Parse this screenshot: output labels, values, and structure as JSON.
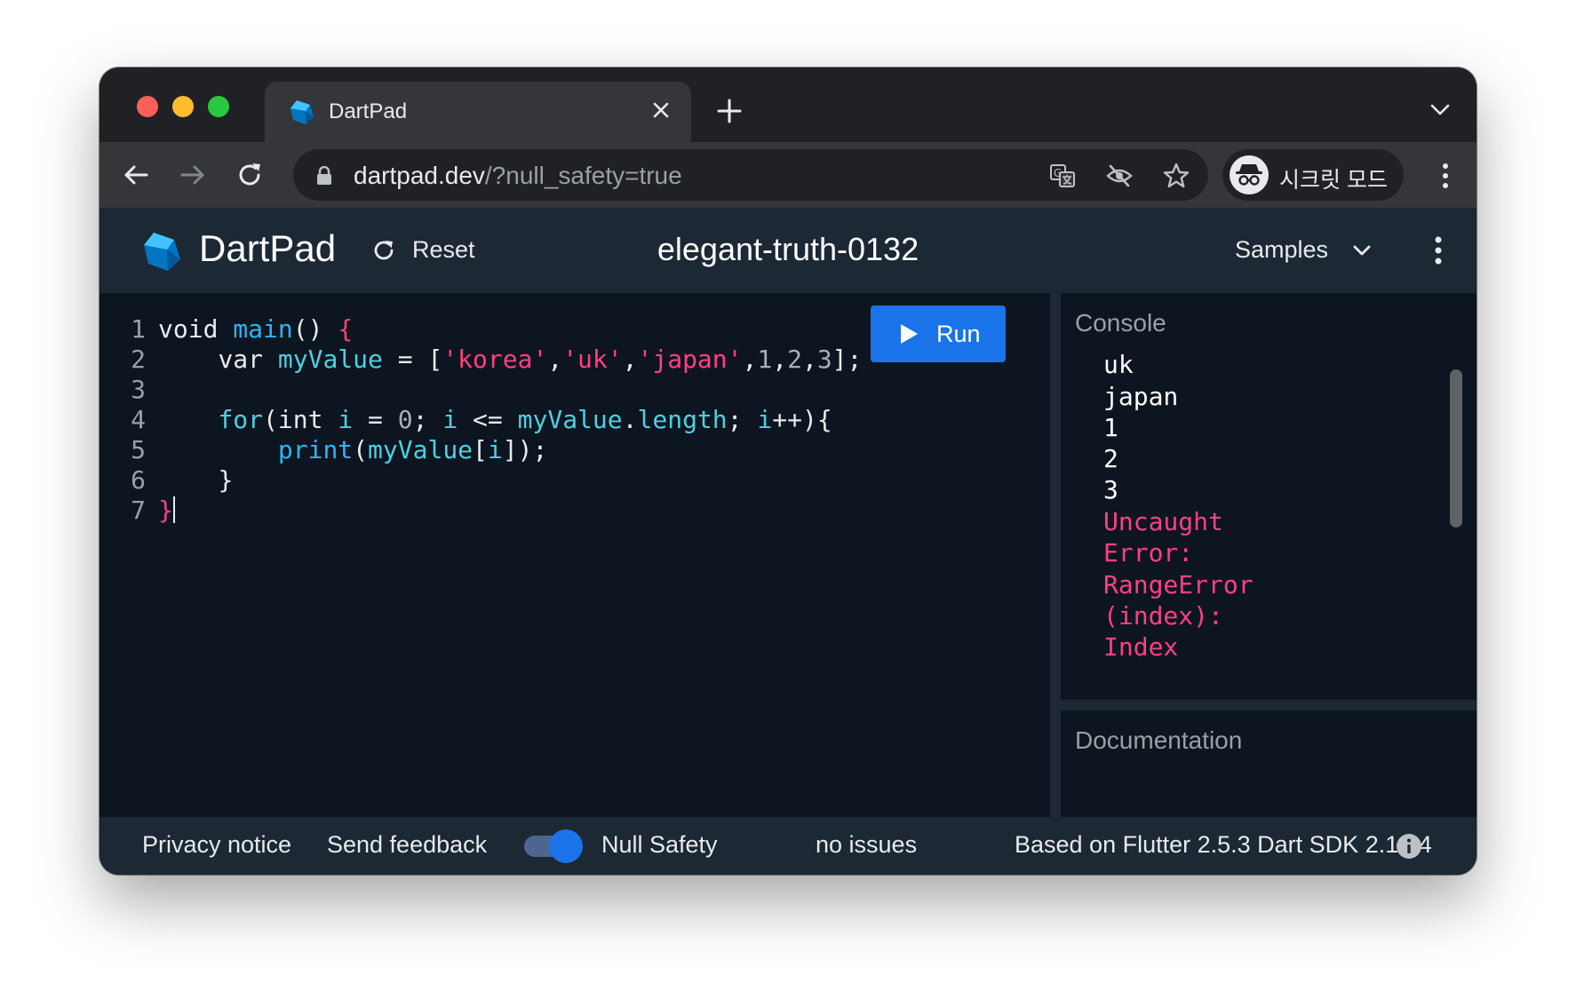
{
  "browser": {
    "tab": {
      "title": "DartPad"
    },
    "address": {
      "host": "dartpad.dev",
      "path": "/?null_safety=true"
    },
    "profile": {
      "label": "시크릿 모드"
    }
  },
  "app": {
    "brand": "DartPad",
    "reset_label": "Reset",
    "pad_title": "elegant-truth-0132",
    "samples_label": "Samples"
  },
  "editor": {
    "line_numbers": [
      "1",
      "2",
      "3",
      "4",
      "5",
      "6",
      "7"
    ],
    "code_lines": [
      "void main() {",
      "    var myValue = ['korea','uk','japan',1,2,3];",
      "",
      "    for(int i = 0; i <= myValue.length; i++){",
      "        print(myValue[i]);",
      "    }",
      "}"
    ],
    "run_label": "Run"
  },
  "console": {
    "title": "Console",
    "lines": [
      "uk",
      "japan",
      "1",
      "2",
      "3"
    ],
    "error_lines": [
      "Uncaught",
      "Error:",
      "RangeError",
      "(index):",
      "Index"
    ]
  },
  "documentation": {
    "title": "Documentation"
  },
  "status": {
    "privacy": "Privacy notice",
    "feedback": "Send feedback",
    "null_safety": "Null Safety",
    "null_safety_enabled": true,
    "issues": "no issues",
    "sdk": "Based on Flutter 2.5.3 Dart SDK 2.14.4"
  },
  "colors": {
    "accent": "#1a73e8",
    "error": "#ff4081",
    "editor_bg": "#0d1520",
    "appbar_bg": "#1c2834"
  },
  "icons": [
    "dart-logo-icon",
    "close-icon",
    "plus-icon",
    "chevron-down-icon",
    "back-arrow-icon",
    "forward-arrow-icon",
    "reload-icon",
    "lock-icon",
    "translate-icon",
    "eye-off-icon",
    "star-icon",
    "incognito-icon",
    "more-vert-icon",
    "refresh-icon",
    "play-icon",
    "info-icon"
  ]
}
